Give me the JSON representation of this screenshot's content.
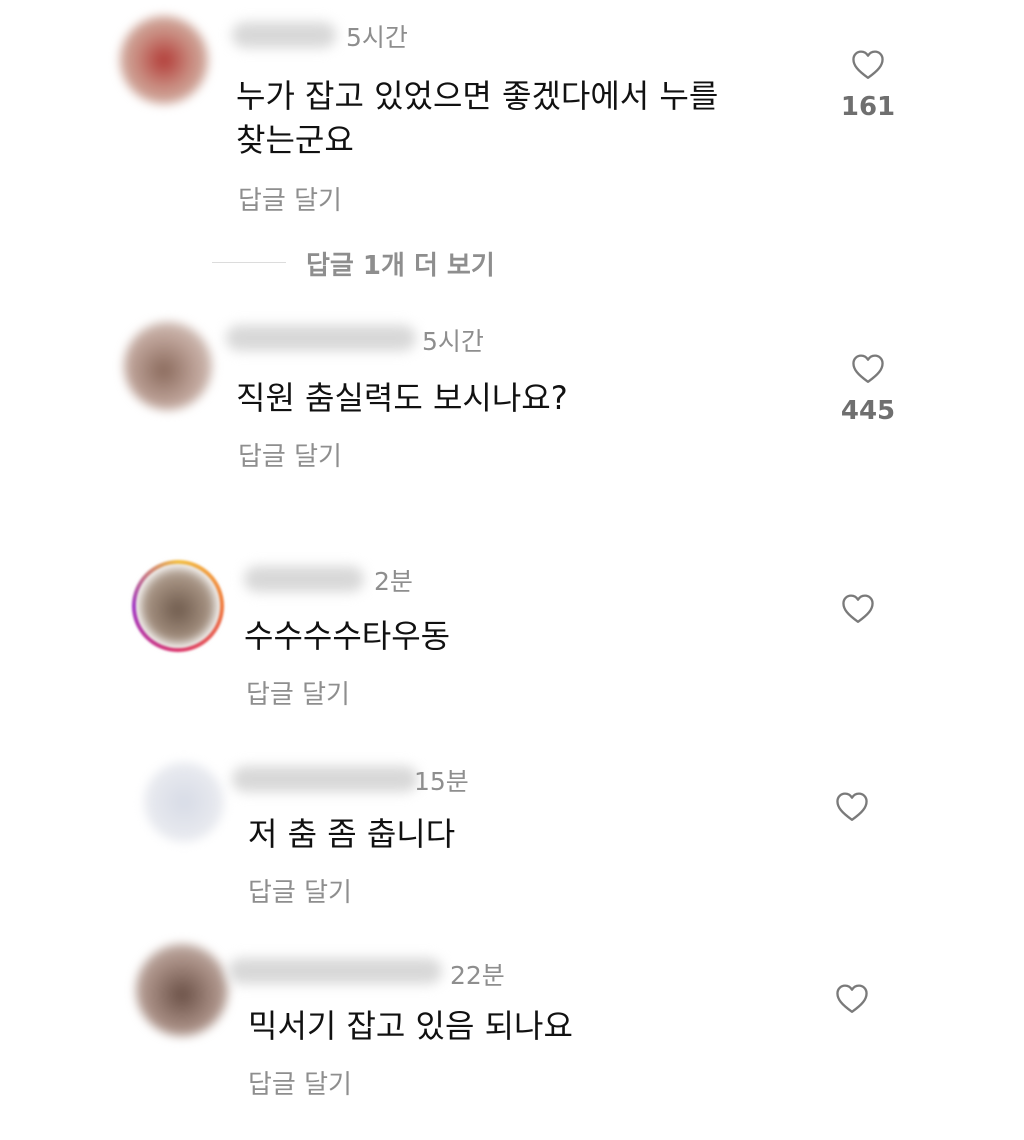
{
  "comments": [
    {
      "time": "5시간",
      "text_line1": "누가 잡고 있었으면 좋겠다에서 누를",
      "text_line2": "찾는군요",
      "reply_label": "답글 달기",
      "likes": "161"
    },
    {
      "time": "5시간",
      "text_line1": "직원 춤실력도 보시나요?",
      "reply_label": "답글 달기",
      "likes": "445"
    },
    {
      "time": "2분",
      "text_line1": "수수수수타우동",
      "reply_label": "답글 달기"
    },
    {
      "time": "15분",
      "text_line1": "저 춤 좀 춥니다",
      "reply_label": "답글 달기"
    },
    {
      "time": "22분",
      "text_line1": "믹서기 잡고 있음 되나요",
      "reply_label": "답글 달기"
    }
  ],
  "more_replies_label": "답글 1개 더 보기",
  "icons": {
    "like": "heart-outline-icon"
  },
  "colors": {
    "secondary_text": "#8e8e8e",
    "like_count": "#6f6f6f",
    "story_ring": "#e1306c"
  }
}
